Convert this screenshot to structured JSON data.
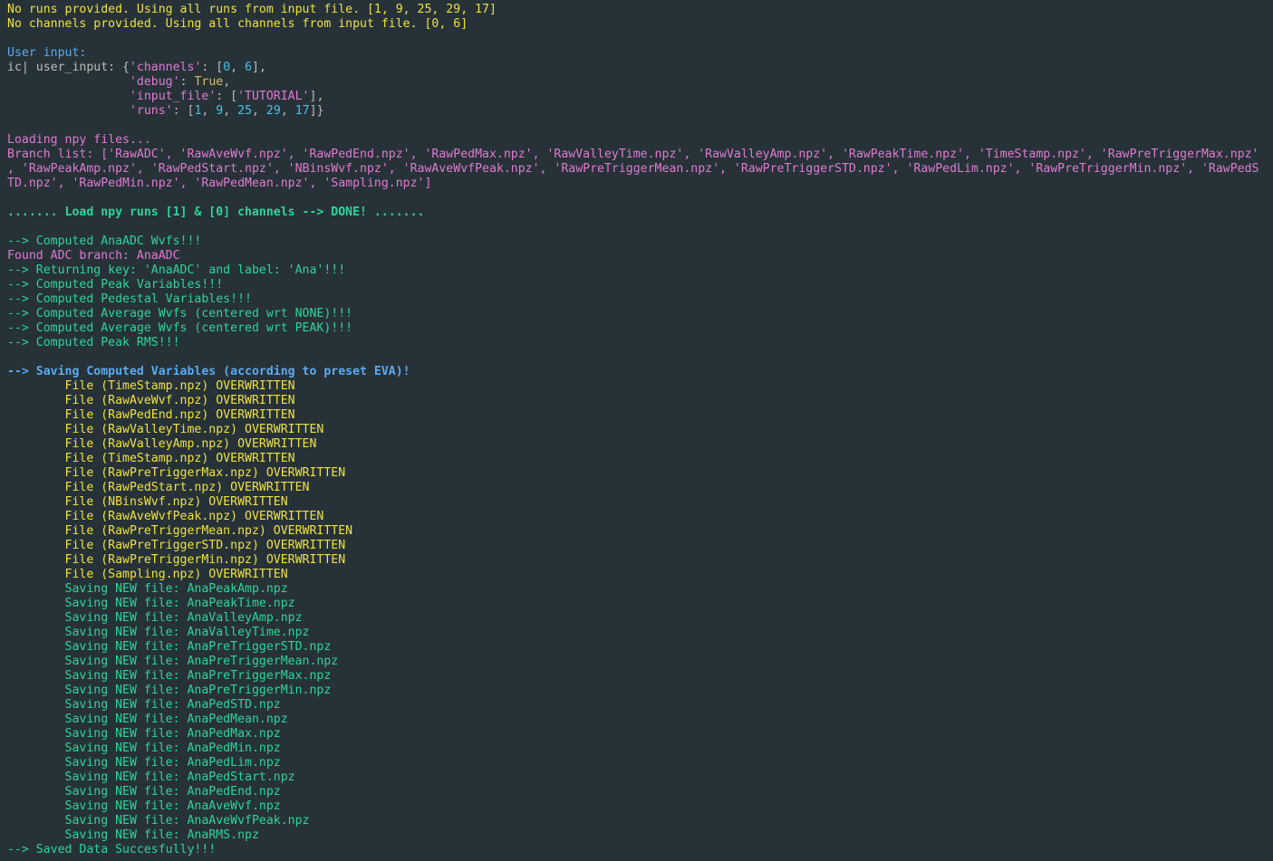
{
  "lines": [
    {
      "segments": [
        {
          "text": "No runs provided. Using all runs from input file. [1, 9, 25, 29, 17]",
          "color": "yellow"
        }
      ]
    },
    {
      "segments": [
        {
          "text": "No channels provided. Using all channels from input file. [0, 6]",
          "color": "yellow"
        }
      ]
    },
    {
      "segments": []
    },
    {
      "segments": [
        {
          "text": "User input:",
          "color": "blue"
        }
      ]
    },
    {
      "segments": [
        {
          "text": "ic| user_input: {",
          "color": "gray"
        },
        {
          "text": "'channels'",
          "color": "str"
        },
        {
          "text": ": [",
          "color": "gray"
        },
        {
          "text": "0",
          "color": "num"
        },
        {
          "text": ", ",
          "color": "gray"
        },
        {
          "text": "6",
          "color": "num"
        },
        {
          "text": "],",
          "color": "gray"
        }
      ]
    },
    {
      "segments": [
        {
          "text": "                 ",
          "color": "gray"
        },
        {
          "text": "'debug'",
          "color": "str"
        },
        {
          "text": ": ",
          "color": "gray"
        },
        {
          "text": "True",
          "color": "kw"
        },
        {
          "text": ",",
          "color": "gray"
        }
      ]
    },
    {
      "segments": [
        {
          "text": "                 ",
          "color": "gray"
        },
        {
          "text": "'input_file'",
          "color": "str"
        },
        {
          "text": ": [",
          "color": "gray"
        },
        {
          "text": "'TUTORIAL'",
          "color": "str"
        },
        {
          "text": "],",
          "color": "gray"
        }
      ]
    },
    {
      "segments": [
        {
          "text": "                 ",
          "color": "gray"
        },
        {
          "text": "'runs'",
          "color": "str"
        },
        {
          "text": ": [",
          "color": "gray"
        },
        {
          "text": "1",
          "color": "num"
        },
        {
          "text": ", ",
          "color": "gray"
        },
        {
          "text": "9",
          "color": "num"
        },
        {
          "text": ", ",
          "color": "gray"
        },
        {
          "text": "25",
          "color": "num"
        },
        {
          "text": ", ",
          "color": "gray"
        },
        {
          "text": "29",
          "color": "num"
        },
        {
          "text": ", ",
          "color": "gray"
        },
        {
          "text": "17",
          "color": "num"
        },
        {
          "text": "]}",
          "color": "gray"
        }
      ]
    },
    {
      "segments": []
    },
    {
      "segments": [
        {
          "text": "Loading npy files...",
          "color": "pink"
        }
      ]
    },
    {
      "segments": [
        {
          "text": "Branch list: ['RawADC', 'RawAveWvf.npz', 'RawPedEnd.npz', 'RawPedMax.npz', 'RawValleyTime.npz', 'RawValleyAmp.npz', 'RawPeakTime.npz', 'TimeStamp.npz', 'RawPreTriggerMax.npz'",
          "color": "pink"
        }
      ]
    },
    {
      "segments": [
        {
          "text": ", 'RawPeakAmp.npz', 'RawPedStart.npz', 'NBinsWvf.npz', 'RawAveWvfPeak.npz', 'RawPreTriggerMean.npz', 'RawPreTriggerSTD.npz', 'RawPedLim.npz', 'RawPreTriggerMin.npz', 'RawPedS",
          "color": "pink"
        }
      ]
    },
    {
      "segments": [
        {
          "text": "TD.npz', 'RawPedMin.npz', 'RawPedMean.npz', 'Sampling.npz']",
          "color": "pink"
        }
      ]
    },
    {
      "segments": []
    },
    {
      "segments": [
        {
          "text": "....... Load npy runs [1] & [0] channels --> DONE! .......",
          "color": "green",
          "bold": true
        }
      ]
    },
    {
      "segments": []
    },
    {
      "segments": [
        {
          "text": "--> Computed AnaADC Wvfs!!!",
          "color": "green"
        }
      ]
    },
    {
      "segments": [
        {
          "text": "Found ADC branch: AnaADC",
          "color": "pink"
        }
      ]
    },
    {
      "segments": [
        {
          "text": "--> Returning key: 'AnaADC' and label: 'Ana'!!!",
          "color": "green"
        }
      ]
    },
    {
      "segments": [
        {
          "text": "--> Computed Peak Variables!!!",
          "color": "green"
        }
      ]
    },
    {
      "segments": [
        {
          "text": "--> Computed Pedestal Variables!!!",
          "color": "green"
        }
      ]
    },
    {
      "segments": [
        {
          "text": "--> Computed Average Wvfs (centered wrt NONE)!!!",
          "color": "green"
        }
      ]
    },
    {
      "segments": [
        {
          "text": "--> Computed Average Wvfs (centered wrt PEAK)!!!",
          "color": "green"
        }
      ]
    },
    {
      "segments": [
        {
          "text": "--> Computed Peak RMS!!!",
          "color": "green"
        }
      ]
    },
    {
      "segments": []
    },
    {
      "segments": [
        {
          "text": "--> Saving Computed Variables (according to preset EVA)!",
          "color": "blue",
          "bold": true
        }
      ]
    },
    {
      "segments": [
        {
          "text": "        File (TimeStamp.npz) OVERWRITTEN",
          "color": "yellow"
        }
      ]
    },
    {
      "segments": [
        {
          "text": "        File (RawAveWvf.npz) OVERWRITTEN",
          "color": "yellow"
        }
      ]
    },
    {
      "segments": [
        {
          "text": "        File (RawPedEnd.npz) OVERWRITTEN",
          "color": "yellow"
        }
      ]
    },
    {
      "segments": [
        {
          "text": "        File (RawValleyTime.npz) OVERWRITTEN",
          "color": "yellow"
        }
      ]
    },
    {
      "segments": [
        {
          "text": "        File (RawValleyAmp.npz) OVERWRITTEN",
          "color": "yellow"
        }
      ]
    },
    {
      "segments": [
        {
          "text": "        File (TimeStamp.npz) OVERWRITTEN",
          "color": "yellow"
        }
      ]
    },
    {
      "segments": [
        {
          "text": "        File (RawPreTriggerMax.npz) OVERWRITTEN",
          "color": "yellow"
        }
      ]
    },
    {
      "segments": [
        {
          "text": "        File (RawPedStart.npz) OVERWRITTEN",
          "color": "yellow"
        }
      ]
    },
    {
      "segments": [
        {
          "text": "        File (NBinsWvf.npz) OVERWRITTEN",
          "color": "yellow"
        }
      ]
    },
    {
      "segments": [
        {
          "text": "        File (RawAveWvfPeak.npz) OVERWRITTEN",
          "color": "yellow"
        }
      ]
    },
    {
      "segments": [
        {
          "text": "        File (RawPreTriggerMean.npz) OVERWRITTEN",
          "color": "yellow"
        }
      ]
    },
    {
      "segments": [
        {
          "text": "        File (RawPreTriggerSTD.npz) OVERWRITTEN",
          "color": "yellow"
        }
      ]
    },
    {
      "segments": [
        {
          "text": "        File (RawPreTriggerMin.npz) OVERWRITTEN",
          "color": "yellow"
        }
      ]
    },
    {
      "segments": [
        {
          "text": "        File (Sampling.npz) OVERWRITTEN",
          "color": "yellow"
        }
      ]
    },
    {
      "segments": [
        {
          "text": "        Saving NEW file: AnaPeakAmp.npz",
          "color": "green"
        }
      ]
    },
    {
      "segments": [
        {
          "text": "        Saving NEW file: AnaPeakTime.npz",
          "color": "green"
        }
      ]
    },
    {
      "segments": [
        {
          "text": "        Saving NEW file: AnaValleyAmp.npz",
          "color": "green"
        }
      ]
    },
    {
      "segments": [
        {
          "text": "        Saving NEW file: AnaValleyTime.npz",
          "color": "green"
        }
      ]
    },
    {
      "segments": [
        {
          "text": "        Saving NEW file: AnaPreTriggerSTD.npz",
          "color": "green"
        }
      ]
    },
    {
      "segments": [
        {
          "text": "        Saving NEW file: AnaPreTriggerMean.npz",
          "color": "green"
        }
      ]
    },
    {
      "segments": [
        {
          "text": "        Saving NEW file: AnaPreTriggerMax.npz",
          "color": "green"
        }
      ]
    },
    {
      "segments": [
        {
          "text": "        Saving NEW file: AnaPreTriggerMin.npz",
          "color": "green"
        }
      ]
    },
    {
      "segments": [
        {
          "text": "        Saving NEW file: AnaPedSTD.npz",
          "color": "green"
        }
      ]
    },
    {
      "segments": [
        {
          "text": "        Saving NEW file: AnaPedMean.npz",
          "color": "green"
        }
      ]
    },
    {
      "segments": [
        {
          "text": "        Saving NEW file: AnaPedMax.npz",
          "color": "green"
        }
      ]
    },
    {
      "segments": [
        {
          "text": "        Saving NEW file: AnaPedMin.npz",
          "color": "green"
        }
      ]
    },
    {
      "segments": [
        {
          "text": "        Saving NEW file: AnaPedLim.npz",
          "color": "green"
        }
      ]
    },
    {
      "segments": [
        {
          "text": "        Saving NEW file: AnaPedStart.npz",
          "color": "green"
        }
      ]
    },
    {
      "segments": [
        {
          "text": "        Saving NEW file: AnaPedEnd.npz",
          "color": "green"
        }
      ]
    },
    {
      "segments": [
        {
          "text": "        Saving NEW file: AnaAveWvf.npz",
          "color": "green"
        }
      ]
    },
    {
      "segments": [
        {
          "text": "        Saving NEW file: AnaAveWvfPeak.npz",
          "color": "green"
        }
      ]
    },
    {
      "segments": [
        {
          "text": "        Saving NEW file: AnaRMS.npz",
          "color": "green"
        }
      ]
    },
    {
      "segments": [
        {
          "text": "--> Saved Data Succesfully!!!",
          "color": "green"
        }
      ]
    }
  ],
  "colors": {
    "background": "#263238",
    "yellow": "#f0e040",
    "blue": "#5aaaf0",
    "pink": "#e07ad0",
    "green": "#2fd39a"
  }
}
